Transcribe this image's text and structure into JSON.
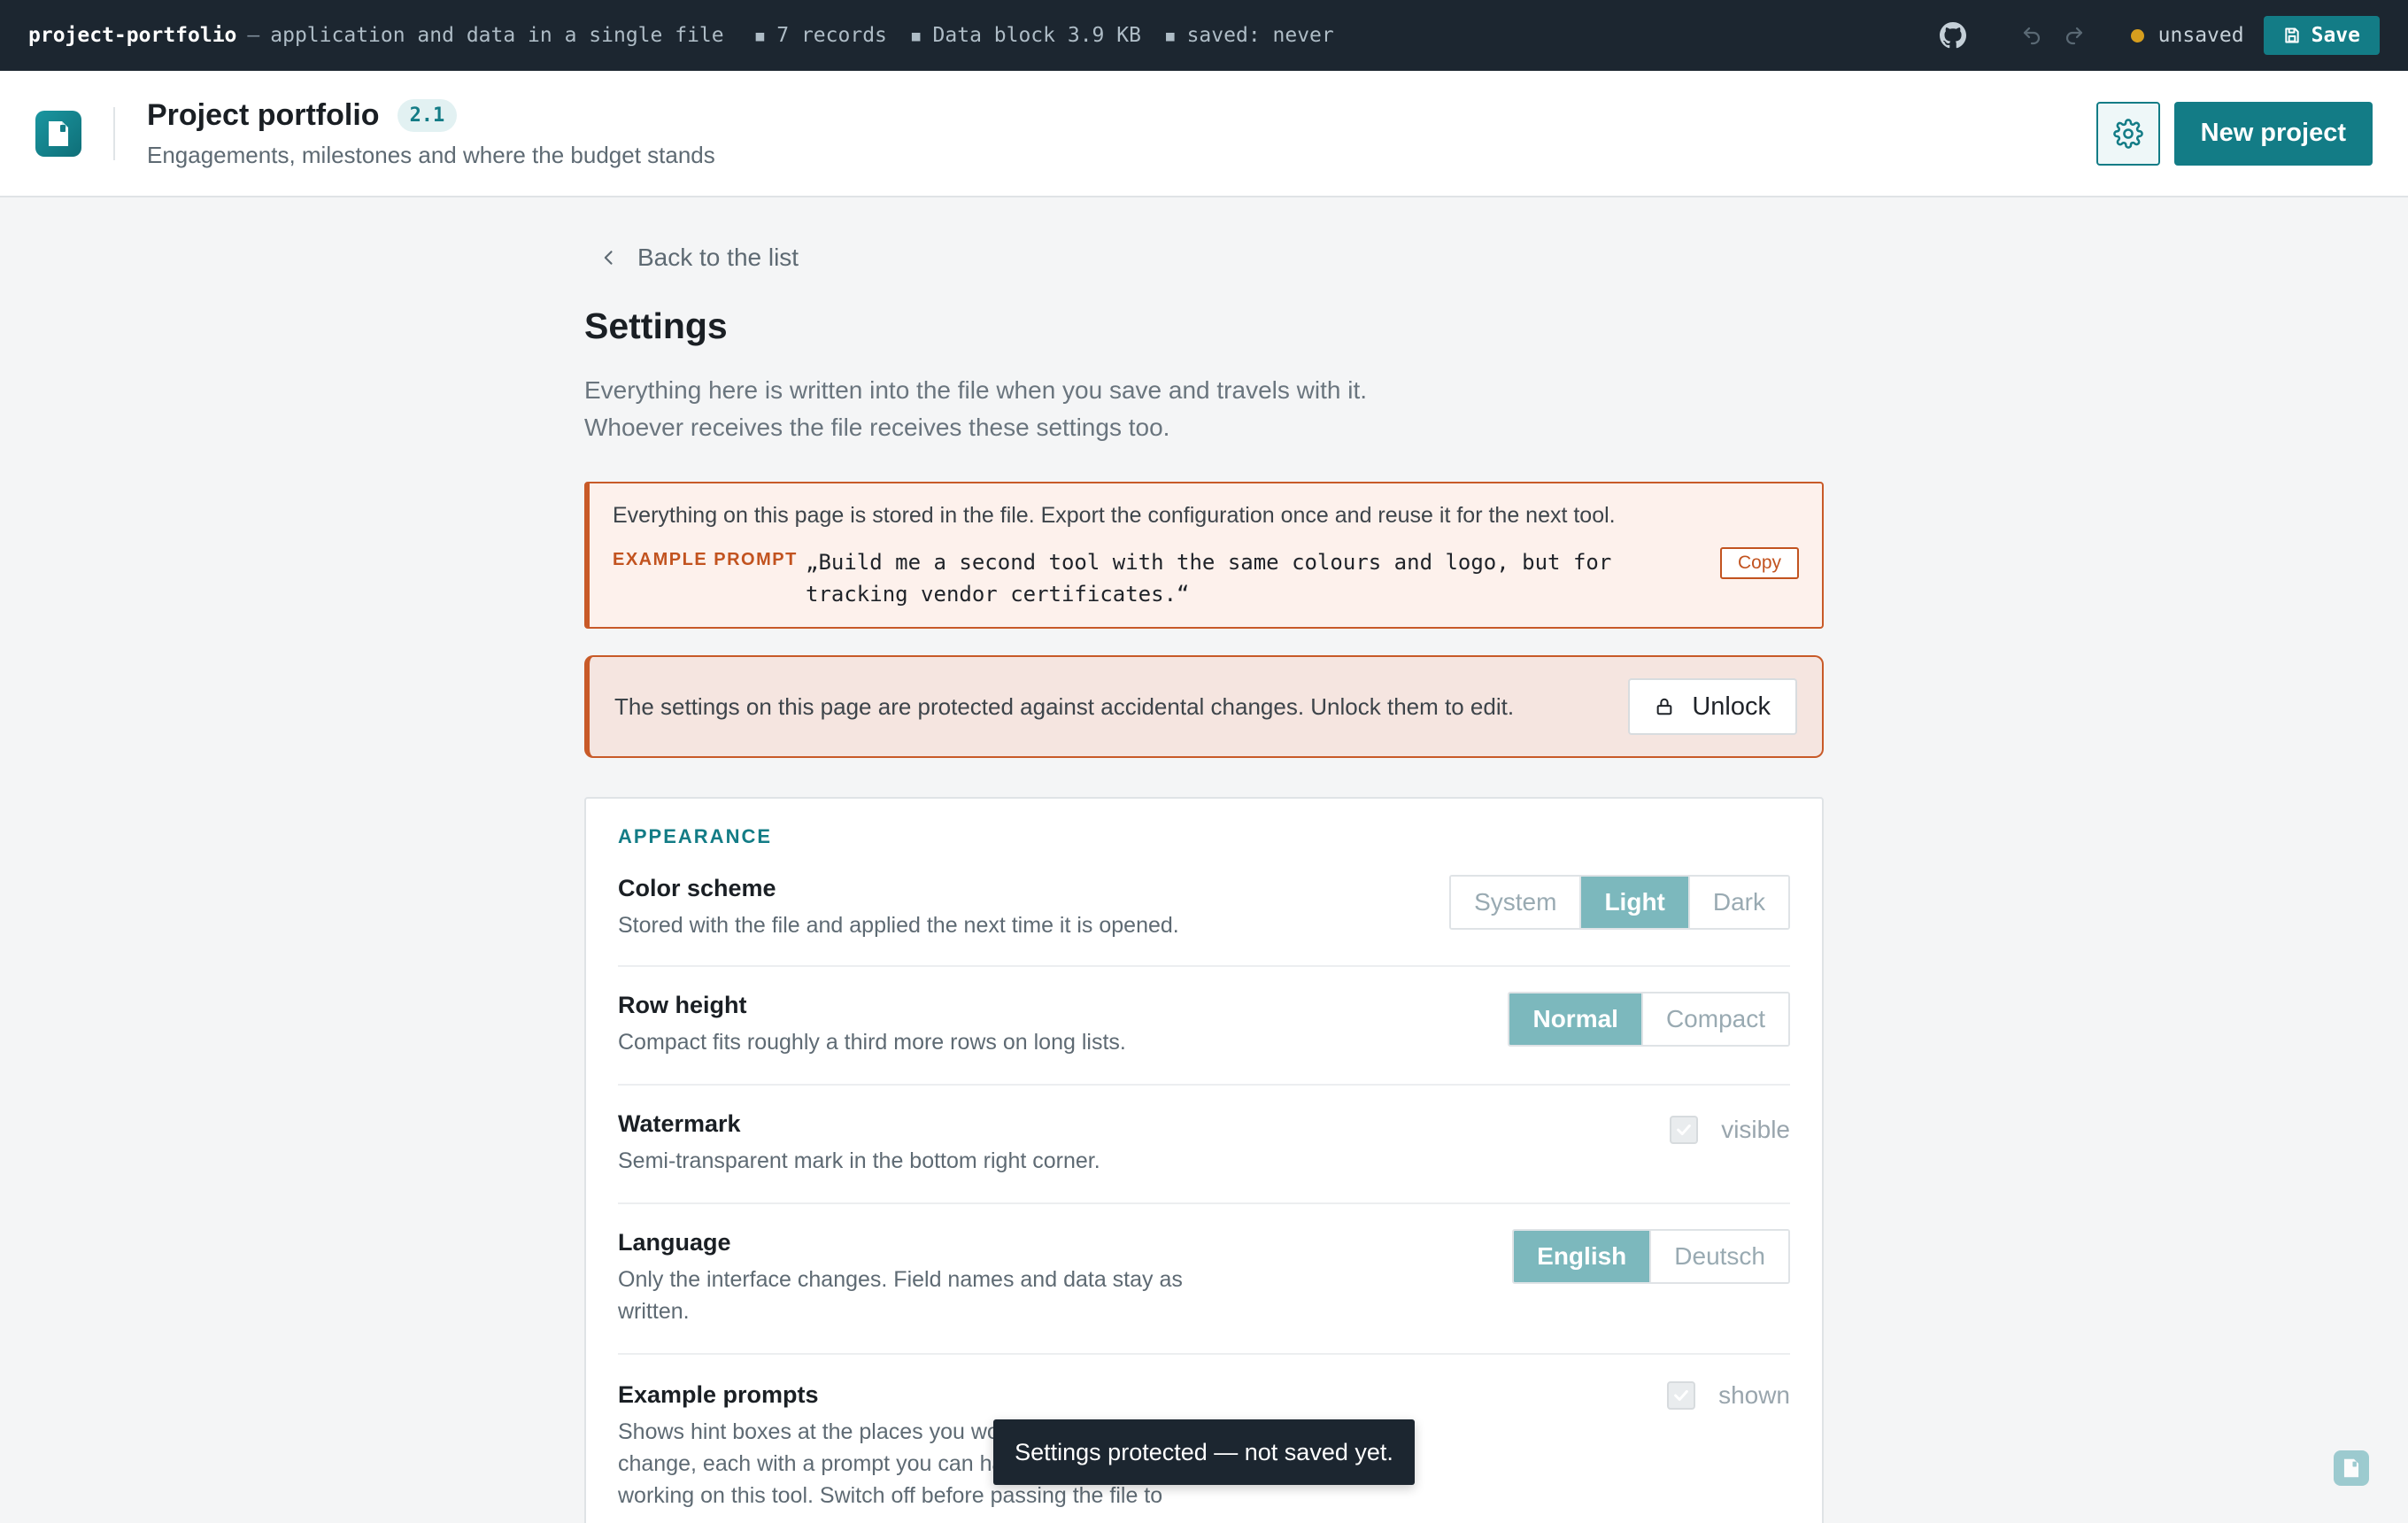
{
  "topbar": {
    "filename": "project-portfolio",
    "separator": "—",
    "tagline": "application and data in a single file",
    "records": "7 records",
    "data_block": "Data block 3.9 KB",
    "saved": "saved: never",
    "status": "unsaved",
    "save_label": "Save",
    "status_color": "#d69e1e"
  },
  "header": {
    "title": "Project portfolio",
    "version": "2.1",
    "subtitle": "Engagements, milestones and where the budget stands",
    "new_project_label": "New project"
  },
  "page": {
    "back_label": "Back to the list",
    "title": "Settings",
    "desc_line1": "Everything here is written into the file when you save and travels with it.",
    "desc_line2": "Whoever receives the file receives these settings too."
  },
  "hint": {
    "text": "Everything on this page is stored in the file. Export the configuration once and reuse it for the next tool.",
    "prompt_label": "EXAMPLE PROMPT",
    "prompt_text": "„Build me a second tool with the same colours and logo, but for tracking vendor certificates.“",
    "copy_label": "Copy"
  },
  "lock": {
    "text": "The settings on this page are protected against accidental changes. Unlock them to edit.",
    "unlock_label": "Unlock"
  },
  "appearance": {
    "section_label": "APPEARANCE",
    "color_scheme": {
      "label": "Color scheme",
      "desc": "Stored with the file and applied the next time it is opened.",
      "options": [
        "System",
        "Light",
        "Dark"
      ],
      "selected": "Light"
    },
    "row_height": {
      "label": "Row height",
      "desc": "Compact fits roughly a third more rows on long lists.",
      "options": [
        "Normal",
        "Compact"
      ],
      "selected": "Normal"
    },
    "watermark": {
      "label": "Watermark",
      "desc": "Semi-transparent mark in the bottom right corner.",
      "check_label": "visible",
      "checked": true
    },
    "language": {
      "label": "Language",
      "desc_line1": "Only the interface changes. Field names and data stay as",
      "desc_line2": "written.",
      "options": [
        "English",
        "Deutsch"
      ],
      "selected": "English"
    },
    "example_prompts": {
      "label": "Example prompts",
      "desc_line1": "Shows hint boxes at the places you would",
      "desc_line2": "change, each with a prompt you can hand on",
      "desc_line3": "working on this tool. Switch off before passing the file to",
      "check_label": "shown",
      "checked": true
    }
  },
  "toast": {
    "text": "Settings protected — not saved yet."
  },
  "colors": {
    "accent": "#137c86",
    "warning": "#c85a28",
    "topbar": "#1c2630"
  }
}
